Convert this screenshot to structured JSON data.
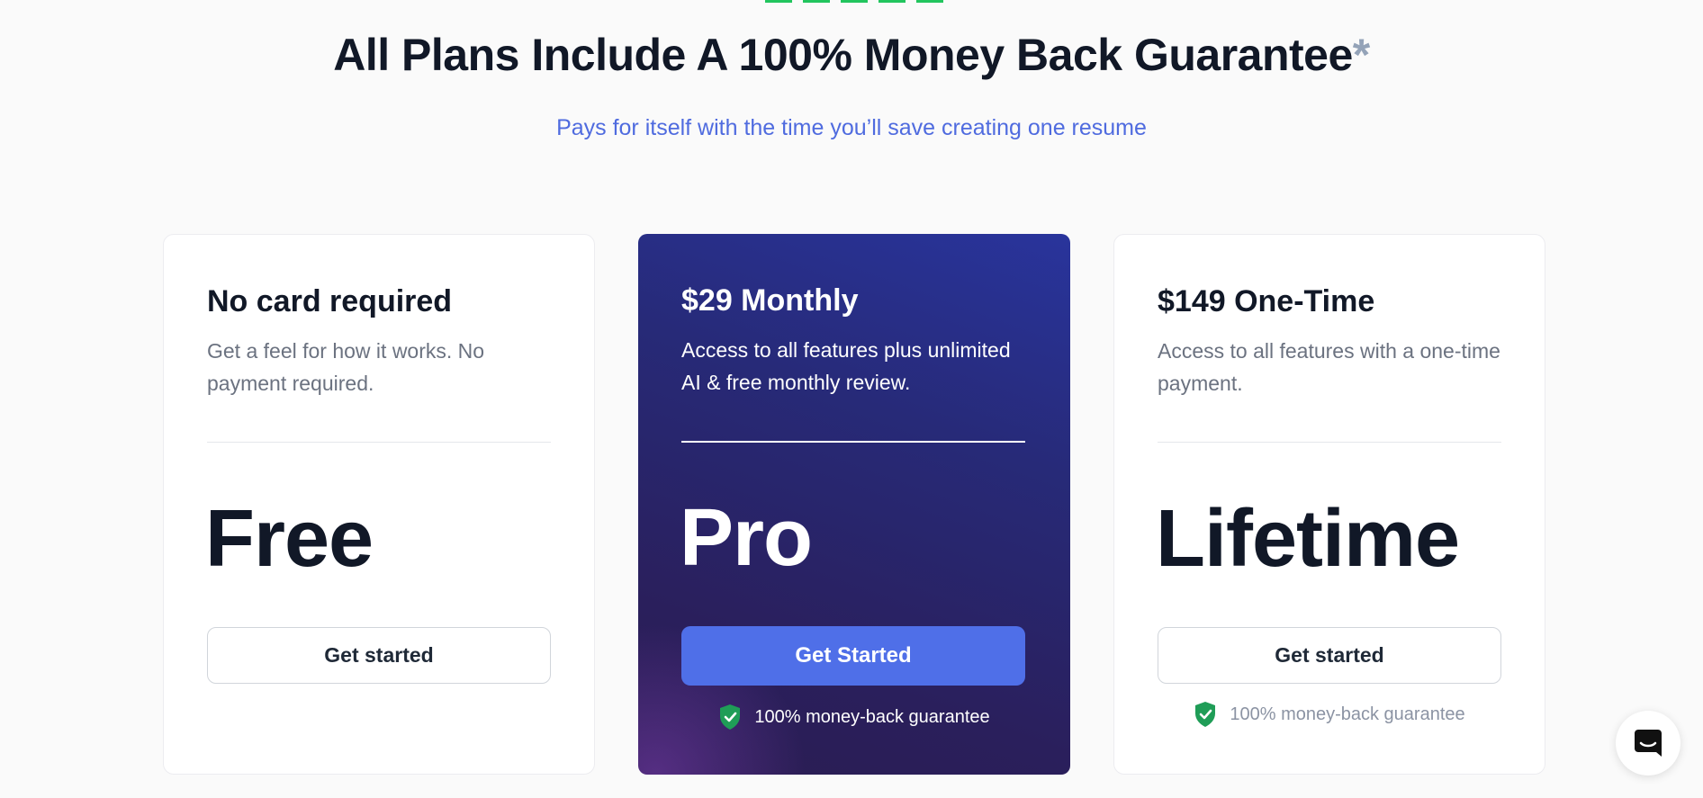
{
  "header": {
    "headline": "All Plans Include A 100% Money Back Guarantee",
    "asterisk": "*",
    "subhead": "Pays for itself with the time you’ll save creating one resume"
  },
  "plans": [
    {
      "title": "No card required",
      "description": "Get a feel for how it works. No payment required.",
      "name": "Free",
      "button_label": "Get started"
    },
    {
      "title": "$29 Monthly",
      "description": "Access to all features plus unlimited AI & free monthly review.",
      "name": "Pro",
      "button_label": "Get Started",
      "guarantee": "100% money-back guarantee"
    },
    {
      "title": "$149 One-Time",
      "description": "Access to all features with a one-time payment.",
      "name": "Lifetime",
      "button_label": "Get started",
      "guarantee": "100% money-back guarantee"
    }
  ],
  "icons": {
    "guarantee": "shield-check-icon",
    "chat": "chat-icon"
  },
  "colors": {
    "accent": "#4f6fe8",
    "guarantee_shield": "#1f9d57",
    "headline": "#111827",
    "subhead": "#4f6bdf"
  }
}
